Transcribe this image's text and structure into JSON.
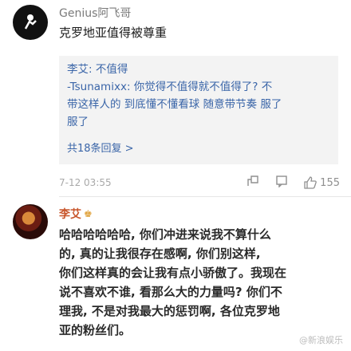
{
  "comment1": {
    "username": "Genius阿飞哥",
    "text": "克罗地亚值得被尊重",
    "quote": {
      "lines": [
        "李艾: 不值得",
        "-Tsunamixx: 你觉得不值得就不值得了? 不",
        "带这样人的 到底懂不懂看球 随意带节奏 服了",
        "服了"
      ],
      "more_replies": "共18条回复 >"
    },
    "time": "7-12 03:55",
    "like_count": "155"
  },
  "comment2": {
    "username": "李艾",
    "crown_icon": "crown-icon",
    "lines": [
      "哈哈哈哈哈哈, 你们冲进来说我不算什么",
      "的, 真的让我很存在感啊, 你们别这样,",
      "你们这样真的会让我有点小骄傲了。我现在",
      "说不喜欢不谁, 看那么大的力量吗? 你们不",
      "理我, 不是对我最大的惩罚啊, 各位克罗地",
      "亚的粉丝们。"
    ]
  },
  "watermark": "@新浪娱乐"
}
